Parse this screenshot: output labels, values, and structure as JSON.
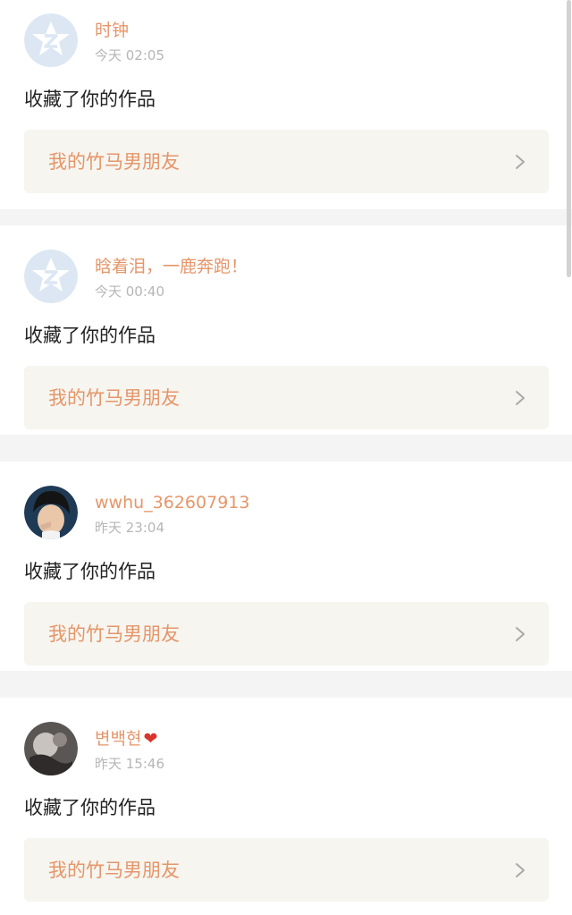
{
  "notifications": [
    {
      "avatar_icon": "default-qzone-star-avatar-icon",
      "name": "时钟",
      "heart": "",
      "time": "今天 02:05",
      "action": "收藏了你的作品",
      "work_title": "我的竹马男朋友"
    },
    {
      "avatar_icon": "default-qzone-star-avatar-icon",
      "name": "晗着泪，一鹿奔跑！",
      "heart": "",
      "time": "今天 00:40",
      "action": "收藏了你的作品",
      "work_title": "我的竹马男朋友"
    },
    {
      "avatar_icon": "user-photo-avatar",
      "name": "wwhu_362607913",
      "heart": "",
      "time": "昨天 23:04",
      "action": "收藏了你的作品",
      "work_title": "我的竹马男朋友"
    },
    {
      "avatar_icon": "user-photo-avatar",
      "name": "변백현",
      "heart": "❤",
      "time": "昨天 15:46",
      "action": "收藏了你的作品",
      "work_title": "我的竹马男朋友"
    }
  ],
  "colors": {
    "accent": "#e5966a",
    "time": "#b6b6b6",
    "link_bg": "#f6f5ef",
    "page_bg": "#f4f4f4",
    "heart": "#d9342b"
  }
}
